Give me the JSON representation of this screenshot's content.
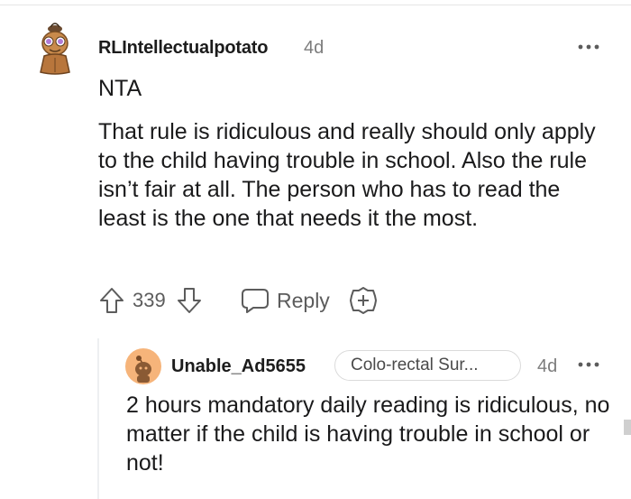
{
  "comment": {
    "author": "RLIntellectualpotato",
    "age": "4d",
    "paragraphs": [
      "NTA",
      "That rule is ridiculous and really should only apply to the child having trouble in school. Also the rule isn’t fair at all. The person who has to read the least is the one that needs it the most."
    ],
    "score": "339",
    "reply_label": "Reply"
  },
  "reply": {
    "author": "Unable_Ad5655",
    "flair": "Colo-rectal Sur...",
    "age": "4d",
    "text": "2 hours mandatory daily reading is ridiculous, no matter if the child is having trouble in school or not!"
  },
  "icons": {
    "avatar1": "cartoon-potato-avatar-icon",
    "avatar2": "snoo-avatar-icon",
    "upvote": "arrow-up-icon",
    "downvote": "arrow-down-icon",
    "reply": "speech-bubble-icon",
    "award": "plus-circle-icon",
    "more": "ellipsis-icon"
  },
  "colors": {
    "text": "#1a1a1b",
    "muted": "#7c7c7c",
    "avatar2_bg": "#f6b47a"
  }
}
